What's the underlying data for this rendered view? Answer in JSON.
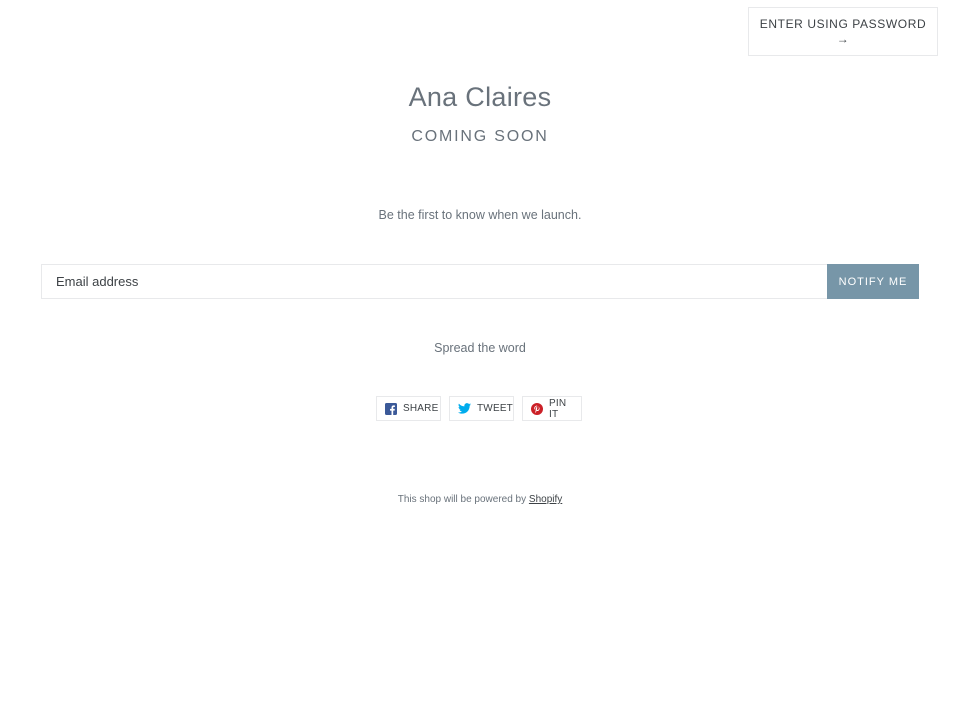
{
  "header": {
    "password_label": "ENTER USING PASSWORD",
    "password_arrow": "→"
  },
  "hero": {
    "brand": "Ana Claires",
    "status": "COMING SOON",
    "tagline": "Be the first to know when we launch."
  },
  "signup": {
    "email_placeholder": "Email address",
    "notify_label": "NOTIFY ME"
  },
  "share": {
    "heading": "Spread the word",
    "buttons": [
      {
        "label": "SHARE",
        "icon": "facebook-icon",
        "color": "#3b5998"
      },
      {
        "label": "TWEET",
        "icon": "twitter-icon",
        "color": "#00aced"
      },
      {
        "label": "PIN IT",
        "icon": "pinterest-icon",
        "color": "#cb2027"
      }
    ]
  },
  "footer": {
    "powered_text": "This shop will be powered by",
    "powered_link": "Shopify"
  },
  "colors": {
    "accent": "#7796a8",
    "text": "#3d4246",
    "muted": "#69727b",
    "border": "#e8e9eb"
  }
}
